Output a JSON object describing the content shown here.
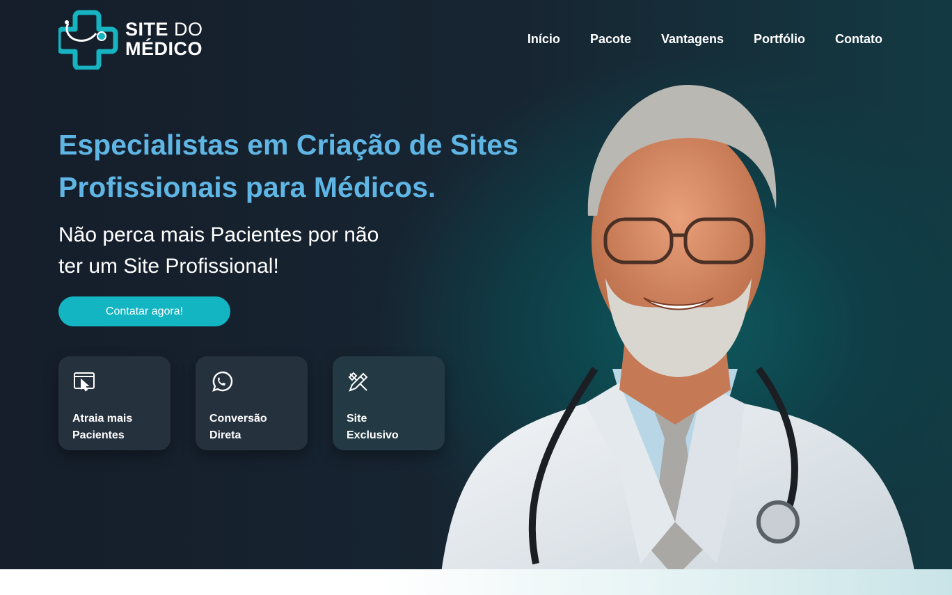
{
  "header": {
    "logo": {
      "line1_bold": "SITE",
      "line1_light": "DO",
      "line2": "MÉDICO"
    },
    "nav": [
      "Início",
      "Pacote",
      "Vantagens",
      "Portfólio",
      "Contato"
    ]
  },
  "hero": {
    "headline_line1": "Especialistas em Criação de Sites",
    "headline_line2": "Profissionais para Médicos.",
    "sub_line1": "Não perca mais Pacientes por não",
    "sub_line2": "ter um Site Profissional!",
    "cta_label": "Contatar agora!",
    "features": [
      {
        "icon": "monitor-cursor-icon",
        "line1": "Atraia mais",
        "line2": "Pacientes"
      },
      {
        "icon": "whatsapp-icon",
        "line1": "Conversão",
        "line2": "Direta"
      },
      {
        "icon": "design-tools-icon",
        "line1": "Site",
        "line2": "Exclusivo"
      }
    ]
  },
  "colors": {
    "accent": "#13b5c3",
    "headline": "#5fb6e4",
    "background": "#151e2a",
    "card": "#26313e"
  }
}
